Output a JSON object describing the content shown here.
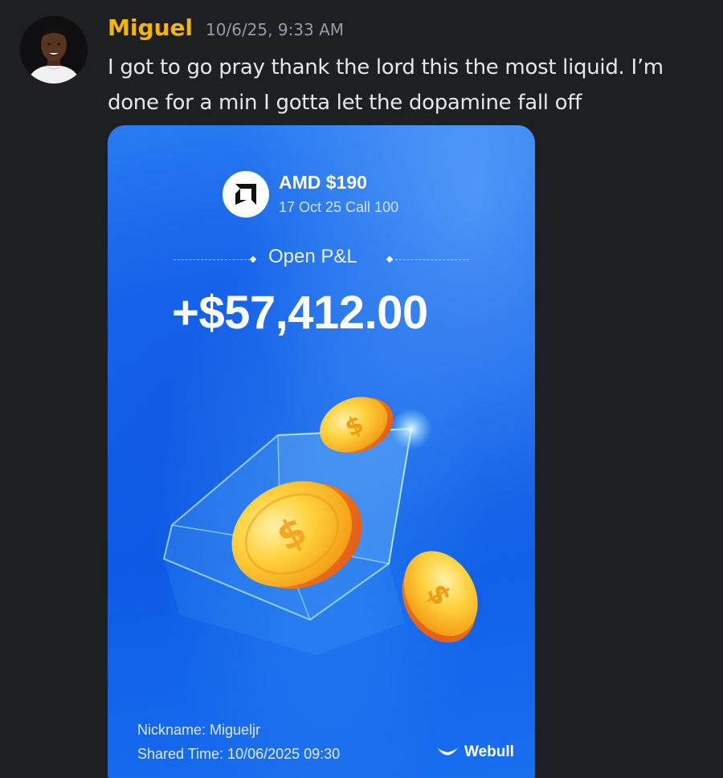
{
  "message": {
    "username": "Miguel",
    "timestamp": "10/6/25, 9:33 AM",
    "text": "I got to go pray thank the lord this the most liquid. I’m done for a min I gotta let the dopamine fall off",
    "username_color": "#f2b705"
  },
  "card": {
    "ticker_title": "AMD $190",
    "ticker_subtitle": "17 Oct 25 Call 100",
    "logo_icon": "amd-logo-icon",
    "pnl_label": "Open P&L",
    "pnl_value": "+$57,412.00",
    "nickname_line": "Nickname: Migueljr",
    "shared_time_line": "Shared Time: 10/06/2025 09:30",
    "brand_name": "Webull",
    "brand_icon": "webull-logo-icon",
    "illustration": "coins-in-glass-cube-illustration",
    "accent_color": "#1466ee"
  }
}
